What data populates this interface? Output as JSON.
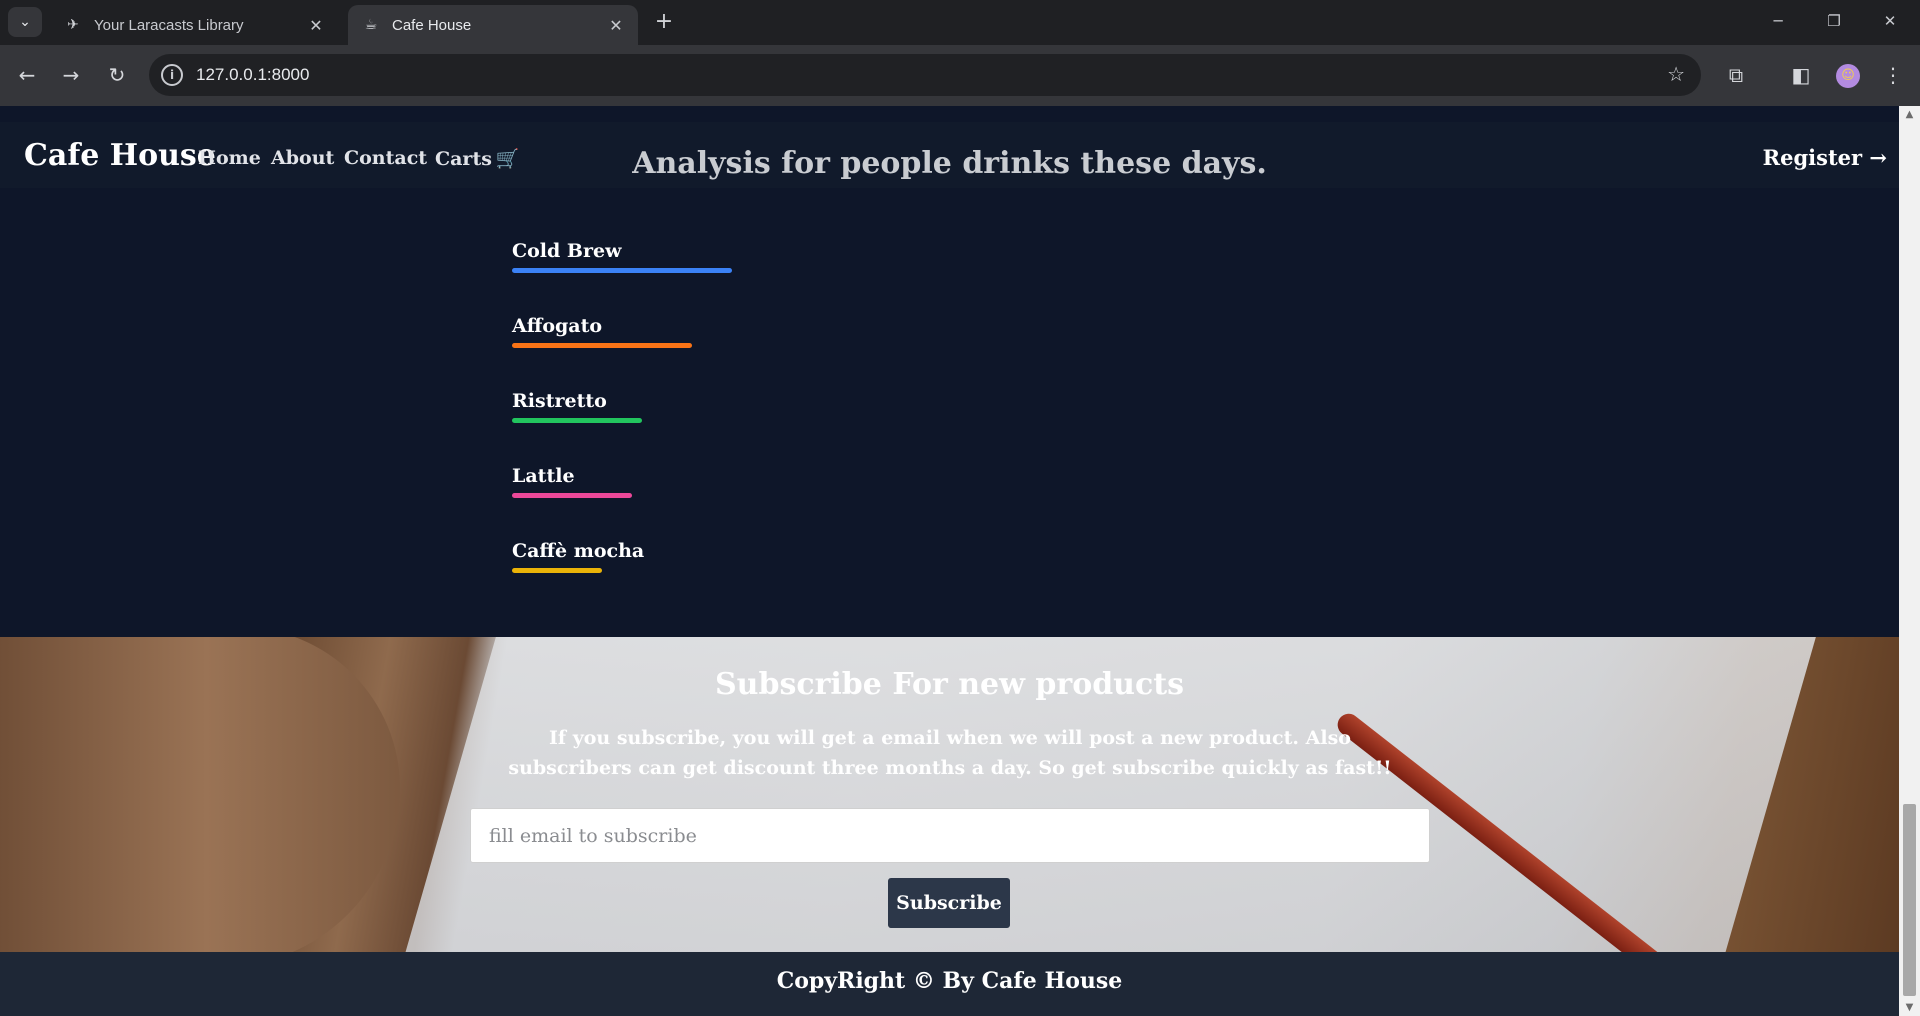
{
  "browser": {
    "tabs": [
      {
        "title": "Your Laracasts Library",
        "favicon": "laracasts-icon",
        "active": false
      },
      {
        "title": "Cafe House",
        "favicon": "cafe-icon",
        "active": true
      }
    ],
    "url": "127.0.0.1:8000",
    "icons": {
      "tab_list": "⌄",
      "close": "✕",
      "new_tab": "+",
      "minimize": "─",
      "restore": "❐",
      "win_close": "✕",
      "back": "←",
      "forward": "→",
      "reload": "↻",
      "info": "i",
      "star": "☆",
      "extensions": "⧉",
      "sidepanel": "◧",
      "menu": "⋮",
      "profile": "☺"
    }
  },
  "navbar": {
    "brand": "Cafe House",
    "links": [
      "Home",
      "About",
      "Contact",
      "Carts"
    ],
    "cart_icon": "🛒",
    "register": "Register",
    "register_arrow": "→"
  },
  "analysis": {
    "title": "Analysis for people drinks these days.",
    "drinks": [
      {
        "label": "Cold Brew",
        "color": "#3b82f6",
        "value": 0.22
      },
      {
        "label": "Affogato",
        "color": "#f97316",
        "value": 0.18
      },
      {
        "label": "Ristretto",
        "color": "#22c55e",
        "value": 0.13
      },
      {
        "label": "Lattle",
        "color": "#ec4899",
        "value": 0.12
      },
      {
        "label": "Caffè mocha",
        "color": "#eab308",
        "value": 0.09
      }
    ]
  },
  "subscribe": {
    "title": "Subscribe For new products",
    "text": "If you subscribe, you will get a email when we will post a new product. Also subscribers can get discount three months a day. So get subscribe quickly as fast!!",
    "placeholder": "fill email to subscribe",
    "button": "Subscribe"
  },
  "footer": {
    "text": "CopyRight © By Cafe House"
  }
}
